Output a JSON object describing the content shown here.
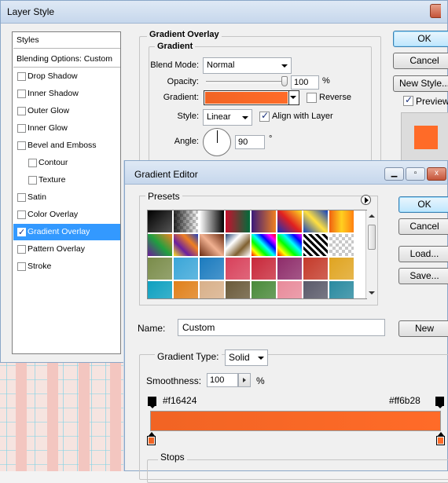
{
  "layer_style": {
    "title": "Layer Style",
    "styles_panel": {
      "header": "Styles",
      "blending": "Blending Options: Custom",
      "items": [
        {
          "label": "Drop Shadow",
          "checked": false,
          "sub": false
        },
        {
          "label": "Inner Shadow",
          "checked": false,
          "sub": false
        },
        {
          "label": "Outer Glow",
          "checked": false,
          "sub": false
        },
        {
          "label": "Inner Glow",
          "checked": false,
          "sub": false
        },
        {
          "label": "Bevel and Emboss",
          "checked": false,
          "sub": false
        },
        {
          "label": "Contour",
          "checked": false,
          "sub": true
        },
        {
          "label": "Texture",
          "checked": false,
          "sub": true
        },
        {
          "label": "Satin",
          "checked": false,
          "sub": false
        },
        {
          "label": "Color Overlay",
          "checked": false,
          "sub": false
        },
        {
          "label": "Gradient Overlay",
          "checked": true,
          "sub": false,
          "selected": true
        },
        {
          "label": "Pattern Overlay",
          "checked": false,
          "sub": false
        },
        {
          "label": "Stroke",
          "checked": false,
          "sub": false
        }
      ]
    },
    "gradient_overlay": {
      "group_title": "Gradient Overlay",
      "sub_title": "Gradient",
      "blend_mode_label": "Blend Mode:",
      "blend_mode_value": "Normal",
      "opacity_label": "Opacity:",
      "opacity_value": "100",
      "opacity_unit": "%",
      "opacity_fraction": 1.0,
      "gradient_label": "Gradient:",
      "reverse_label": "Reverse",
      "reverse_checked": false,
      "style_label": "Style:",
      "style_value": "Linear",
      "align_label": "Align with Layer",
      "align_checked": true,
      "angle_label": "Angle:",
      "angle_value": "90",
      "angle_unit": "°"
    },
    "buttons": {
      "ok": "OK",
      "cancel": "Cancel",
      "new_style": "New Style...",
      "preview": "Preview"
    },
    "preview_checked": true,
    "preview_color": "#ff6b28"
  },
  "gradient_editor": {
    "title": "Gradient Editor",
    "window_buttons": {
      "minimize": "▁",
      "restore": "▫",
      "close": "x"
    },
    "presets_label": "Presets",
    "buttons": {
      "ok": "OK",
      "cancel": "Cancel",
      "load": "Load...",
      "save": "Save...",
      "new": "New"
    },
    "name_label": "Name:",
    "name_value": "Custom",
    "gradient_type_label": "Gradient Type:",
    "gradient_type_value": "Solid",
    "smoothness_label": "Smoothness:",
    "smoothness_value": "100",
    "smoothness_unit": "%",
    "stop_left_label": "#f16424",
    "stop_right_label": "#ff6b28",
    "stops_label": "Stops",
    "gradient_colors": [
      "#f16424",
      "#ff6b28"
    ],
    "presets_rows": [
      [
        "black-white",
        "checker-black",
        "white-black",
        "red-green",
        "violet-orange",
        "blue-red-yellow",
        "blue-yellow-blue",
        "orange-yellow"
      ],
      [
        "violet-green-orange",
        "yellow-violet-orange-blue",
        "copper",
        "chrome",
        "spectrum",
        "transparent-rainbow",
        "transparent-stripes",
        "checker"
      ],
      [
        "#7a8c4a",
        "#3aa6d8",
        "#1b7bbf",
        "#d8405a",
        "#c8283a",
        "#8e2c6a",
        "#c43a2a",
        "#e0a420"
      ],
      [
        "#0ea0c0",
        "#e0801a",
        "#d8b08a",
        "#6a5a3a",
        "#4a8a3a",
        "#e88a9a",
        "#5a5a6a",
        "#2a8aa0"
      ]
    ]
  },
  "colors": {
    "accent_selected": "#3399ff",
    "orange": "#ff6b28"
  }
}
